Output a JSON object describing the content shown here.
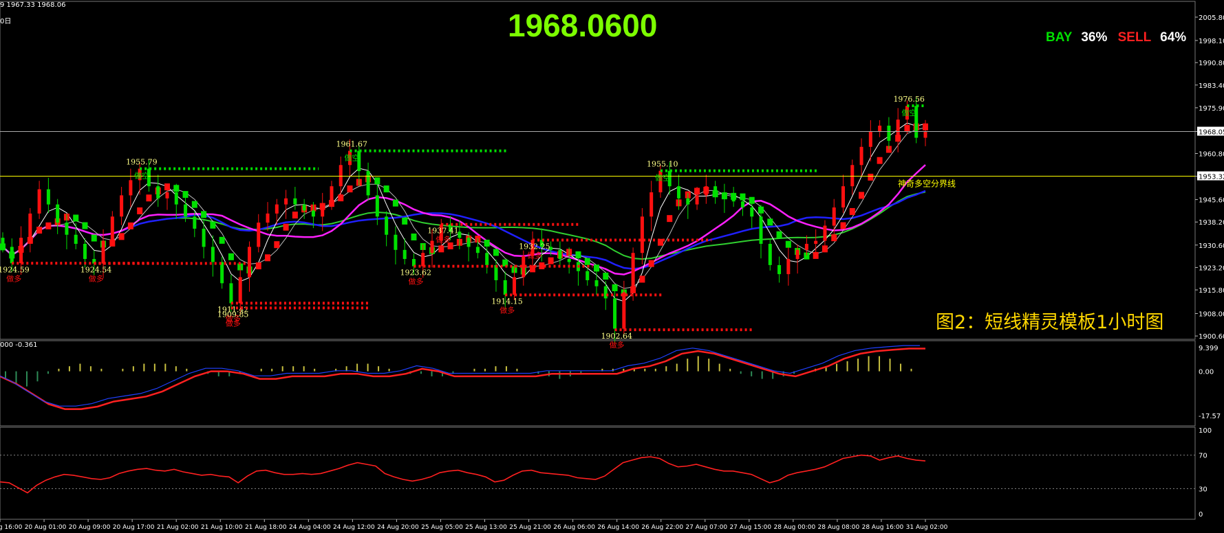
{
  "header": {
    "ohlc_fragment": "9 1967.33 1968.06",
    "period_fragment": "0日"
  },
  "current_price_big": "1968.0600",
  "sentiment": {
    "bay_label": "BAY",
    "bay_pct": "36%",
    "sell_label": "SELL",
    "sell_pct": "64%"
  },
  "caption": "图2：短线精灵模板1小时图",
  "boundary_label": "神奇多空分界线",
  "macd_header": "000 -0.361",
  "colors": {
    "bull": "#00e000",
    "bear": "#ff1010",
    "ma_blue": "#2020ff",
    "ma_magenta": "#ff20ff",
    "ma_green": "#30d030",
    "level_line": "#ffff00",
    "price_text": "#7CFC00"
  },
  "chart_data": [
    {
      "type": "candlestick",
      "title": "",
      "price_axis_ticks": [
        "2005.80",
        "1998.10",
        "1990.80",
        "1983.40",
        "1975.90",
        "1968.05",
        "1960.80",
        "1953.32",
        "1945.60",
        "1938.20",
        "1930.60",
        "1923.20",
        "1915.80",
        "1908.00",
        "1900.60"
      ],
      "current_price": 1968.05,
      "horizontal_level": 1953.32,
      "ylim": [
        1899.5,
        2011
      ],
      "close_series": [
        1930,
        1924.6,
        1933,
        1941,
        1949,
        1944,
        1938,
        1934,
        1931,
        1926,
        1924.5,
        1932,
        1940,
        1947,
        1952,
        1955.8,
        1950,
        1946,
        1948,
        1944,
        1940,
        1936,
        1930,
        1925,
        1918,
        1911.4,
        1920,
        1930,
        1938,
        1941,
        1944,
        1946,
        1944,
        1942,
        1940,
        1944,
        1950,
        1957,
        1961.7,
        1955,
        1947,
        1940,
        1934,
        1929,
        1926,
        1923.6,
        1928,
        1932,
        1937.4,
        1935,
        1933,
        1930,
        1928,
        1924,
        1919,
        1914.2,
        1920,
        1927,
        1932.3,
        1930,
        1929,
        1926,
        1925,
        1922,
        1919,
        1917,
        1913,
        1903,
        1915,
        1928,
        1940,
        1948,
        1955.1,
        1950,
        1946,
        1944,
        1947,
        1950,
        1948,
        1946,
        1945,
        1943,
        1940,
        1931,
        1924,
        1921,
        1926,
        1929,
        1931,
        1932,
        1937,
        1943,
        1950,
        1957,
        1963,
        1968,
        1970,
        1965,
        1972,
        1976.5,
        1966,
        1968.06
      ],
      "labeled_prices": [
        "1924.59",
        "1924.54",
        "1955.79",
        "1911.42",
        "1961.67",
        "1923.62",
        "1937.41",
        "1914.15",
        "1932.25",
        "1902.64",
        "1955.10",
        "1976.56",
        "1909.85"
      ],
      "signal_labels": [
        "做空",
        "做多"
      ]
    },
    {
      "type": "line",
      "name_visible": "000 -0.361",
      "ticks": [
        "9.399",
        "0.00",
        "-17.57"
      ],
      "ylim": [
        -20,
        10.5
      ],
      "histogram": [
        -3,
        -5,
        -6,
        -4,
        -1,
        1,
        2,
        3,
        2,
        1,
        0,
        1,
        2,
        3,
        3,
        3,
        2,
        1,
        0,
        -1,
        -2,
        -2,
        -1,
        0,
        1,
        1,
        2,
        2,
        2,
        1,
        0,
        1,
        2,
        3,
        3,
        2,
        1,
        0,
        -1,
        -1,
        -2,
        -2,
        -1,
        0,
        1,
        1,
        2,
        2,
        1,
        0,
        -1,
        -2,
        -3,
        -2,
        -1,
        0,
        1,
        1,
        1,
        1,
        1,
        1,
        2,
        3,
        5,
        6,
        5,
        3,
        1,
        -1,
        -2,
        -3,
        -3,
        -2,
        -1,
        0,
        1,
        2,
        3,
        4,
        5,
        6,
        6,
        5,
        3,
        1,
        0
      ],
      "signal_line": [
        -2,
        -5,
        -9,
        -13,
        -15,
        -15,
        -14,
        -12,
        -11,
        -10,
        -8,
        -5,
        -2,
        0,
        0,
        -1,
        -3,
        -3,
        -2,
        -2,
        -2,
        -1,
        -1,
        -2,
        -2,
        -1,
        1,
        0,
        -2,
        -2,
        -2,
        -2,
        -2,
        -2,
        -1,
        -1,
        -1,
        -1,
        -1,
        1,
        2,
        4,
        7,
        8,
        7,
        5,
        3,
        1,
        -1,
        -2,
        0,
        2,
        5,
        7,
        8,
        8.5,
        9,
        9
      ]
    },
    {
      "type": "line",
      "ticks": [
        "100",
        "70",
        "30",
        "0"
      ],
      "ylim": [
        0,
        100
      ],
      "reference_levels": [
        70,
        30
      ],
      "values": [
        38,
        37,
        31,
        25,
        34,
        40,
        44,
        47,
        46,
        44,
        42,
        41,
        43,
        48,
        51,
        53,
        54,
        52,
        51,
        53,
        50,
        48,
        46,
        47,
        45,
        44,
        37,
        45,
        51,
        52,
        49,
        47,
        47,
        48,
        47,
        48,
        51,
        54,
        58,
        61,
        59,
        57,
        48,
        44,
        41,
        39,
        41,
        44,
        49,
        51,
        52,
        49,
        47,
        44,
        38,
        40,
        46,
        51,
        52,
        49,
        48,
        47,
        46,
        43,
        42,
        41,
        45,
        53,
        61,
        64,
        67,
        68,
        66,
        60,
        56,
        57,
        59,
        56,
        53,
        51,
        51,
        49,
        47,
        42,
        37,
        40,
        46,
        49,
        51,
        53,
        56,
        61,
        66,
        68,
        70,
        69,
        64,
        67,
        69,
        66,
        64,
        63
      ],
      "x_tick_labels": [
        "19 Aug 16:00",
        "20 Aug 01:00",
        "20 Aug 09:00",
        "20 Aug 17:00",
        "21 Aug 02:00",
        "21 Aug 10:00",
        "21 Aug 18:00",
        "24 Aug 04:00",
        "24 Aug 12:00",
        "24 Aug 20:00",
        "25 Aug 05:00",
        "25 Aug 13:00",
        "25 Aug 21:00",
        "26 Aug 06:00",
        "26 Aug 14:00",
        "26 Aug 22:00",
        "27 Aug 07:00",
        "27 Aug 15:00",
        "28 Aug 00:00",
        "28 Aug 08:00",
        "28 Aug 16:00",
        "31 Aug 02:00"
      ]
    }
  ]
}
